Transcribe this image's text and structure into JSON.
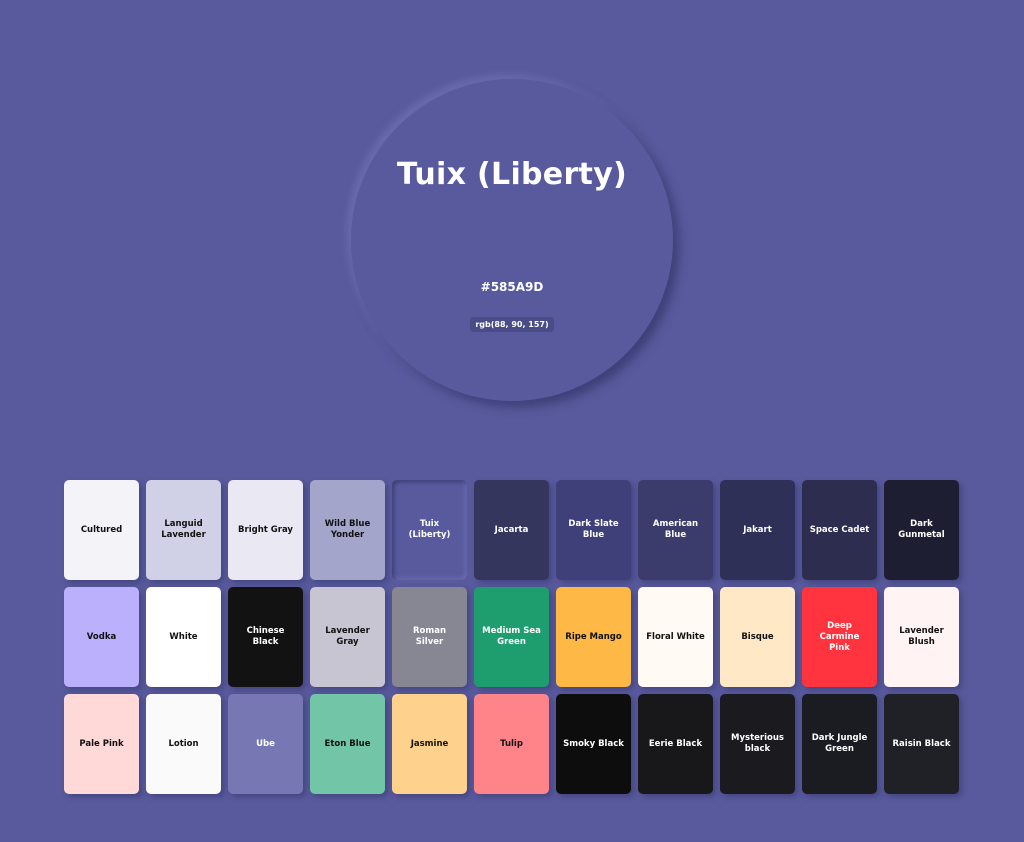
{
  "hero": {
    "name": "Tuix (Liberty)",
    "hex": "#585A9D",
    "rgb": "rgb(88, 90, 157)"
  },
  "swatches": [
    {
      "name": "Cultured",
      "bg": "#F4F3F8",
      "fg": "#111111"
    },
    {
      "name": "Languid Lavender",
      "bg": "#D0D0E6",
      "fg": "#111111"
    },
    {
      "name": "Bright Gray",
      "bg": "#E9E8F3",
      "fg": "#111111"
    },
    {
      "name": "Wild Blue Yonder",
      "bg": "#A3A5CB",
      "fg": "#111111"
    },
    {
      "name": "Tuix (Liberty)",
      "bg": "#585A9D",
      "fg": "#FFFFFF",
      "selected": true
    },
    {
      "name": "Jacarta",
      "bg": "#34365E",
      "fg": "#FFFFFF"
    },
    {
      "name": "Dark Slate Blue",
      "bg": "#3F3F7A",
      "fg": "#FFFFFF"
    },
    {
      "name": "American Blue",
      "bg": "#3B3C6B",
      "fg": "#FFFFFF"
    },
    {
      "name": "Jakart",
      "bg": "#2F3058",
      "fg": "#FFFFFF"
    },
    {
      "name": "Space Cadet",
      "bg": "#2D2E4F",
      "fg": "#FFFFFF"
    },
    {
      "name": "Dark Gunmetal",
      "bg": "#1E1E33",
      "fg": "#FFFFFF"
    },
    {
      "name": "Vodka",
      "bg": "#BAB0FB",
      "fg": "#111111"
    },
    {
      "name": "White",
      "bg": "#FFFFFF",
      "fg": "#111111"
    },
    {
      "name": "Chinese Black",
      "bg": "#121212",
      "fg": "#FFFFFF"
    },
    {
      "name": "Lavender Gray",
      "bg": "#C7C5D1",
      "fg": "#111111"
    },
    {
      "name": "Roman Silver",
      "bg": "#878693",
      "fg": "#FFFFFF"
    },
    {
      "name": "Medium Sea Green",
      "bg": "#1E9E6E",
      "fg": "#FFFFFF"
    },
    {
      "name": "Ripe Mango",
      "bg": "#FDB845",
      "fg": "#111111"
    },
    {
      "name": "Floral White",
      "bg": "#FFFBF4",
      "fg": "#111111"
    },
    {
      "name": "Bisque",
      "bg": "#FFE8C5",
      "fg": "#111111"
    },
    {
      "name": "Deep Carmine Pink",
      "bg": "#FF343F",
      "fg": "#FFFFFF"
    },
    {
      "name": "Lavender Blush",
      "bg": "#FFF3F3",
      "fg": "#111111"
    },
    {
      "name": "Pale Pink",
      "bg": "#FFD8D8",
      "fg": "#111111"
    },
    {
      "name": "Lotion",
      "bg": "#FAFAFA",
      "fg": "#111111"
    },
    {
      "name": "Ube",
      "bg": "#7778B3",
      "fg": "#FFFFFF"
    },
    {
      "name": "Eton Blue",
      "bg": "#72C6A7",
      "fg": "#111111"
    },
    {
      "name": "Jasmine",
      "bg": "#FED28C",
      "fg": "#111111"
    },
    {
      "name": "Tulip",
      "bg": "#FF848A",
      "fg": "#111111"
    },
    {
      "name": "Smoky Black",
      "bg": "#0D0D0D",
      "fg": "#FFFFFF"
    },
    {
      "name": "Eerie Black",
      "bg": "#18181B",
      "fg": "#FFFFFF"
    },
    {
      "name": "Mysterious black",
      "bg": "#1A1A1F",
      "fg": "#FFFFFF"
    },
    {
      "name": "Dark Jungle Green",
      "bg": "#1B1C22",
      "fg": "#FFFFFF"
    },
    {
      "name": "Raisin Black",
      "bg": "#202126",
      "fg": "#FFFFFF"
    }
  ]
}
